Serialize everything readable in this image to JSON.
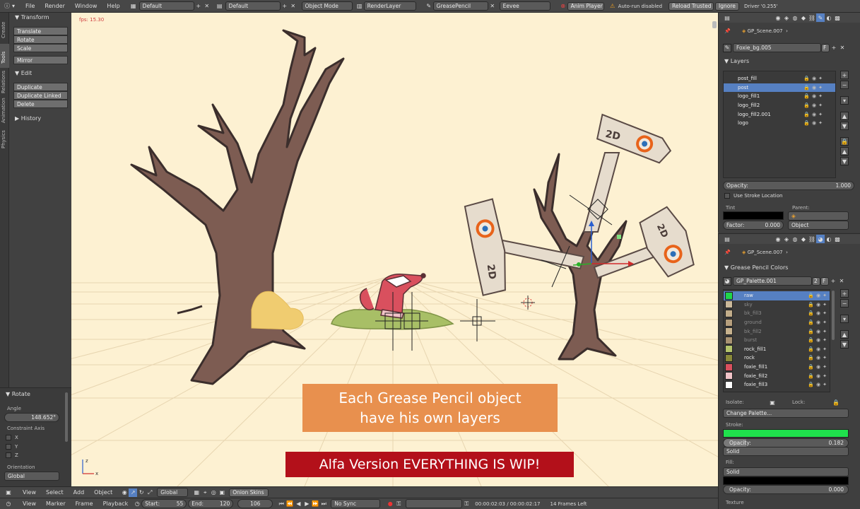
{
  "topbar": {
    "menus": [
      "File",
      "Render",
      "Window",
      "Help"
    ],
    "layout": "Default",
    "scene": "Default",
    "mode": "Object Mode",
    "render_layer": "RenderLayer",
    "object": "GreasePencil",
    "engine": "Eevee",
    "anim_player": "Anim Player",
    "autorun": "Auto-run disabled",
    "reload": "Reload Trusted",
    "ignore": "Ignore",
    "driver": "Driver '0.255'"
  },
  "vtabs": [
    "Create",
    "Tools",
    "Relations",
    "Animation",
    "Physics"
  ],
  "toolshelf": {
    "transform_header": "Transform",
    "transform_buttons": [
      "Translate",
      "Rotate",
      "Scale"
    ],
    "mirror": "Mirror",
    "edit_header": "Edit",
    "edit_buttons": [
      "Duplicate",
      "Duplicate Linked",
      "Delete"
    ],
    "history_header": "History"
  },
  "operator": {
    "header": "Rotate",
    "angle_label": "Angle",
    "angle_value": "148.652°",
    "constraint_label": "Constraint Axis",
    "axes": [
      "X",
      "Y",
      "Z"
    ],
    "orientation_label": "Orientation",
    "orientation_value": "Global"
  },
  "viewport": {
    "fps": "fps: 15.30",
    "caption_line1": "Each Grease Pencil object",
    "caption_line2": "have his own layers",
    "banner": "Alfa Version EVERYTHING IS WIP!",
    "sign_text": "2D",
    "axis_z": "z",
    "axis_x": "x"
  },
  "view3d_header": {
    "menus": [
      "View",
      "Select",
      "Add",
      "Object"
    ],
    "orientation": "Global",
    "onion": "Onion Skins"
  },
  "timeline": {
    "menus": [
      "View",
      "Marker",
      "Frame",
      "Playback"
    ],
    "start_label": "Start:",
    "start": "55",
    "end_label": "End:",
    "end": "120",
    "current": "106",
    "sync": "No Sync",
    "time": "00:00:02:03 / 00:00:02:17",
    "frames_left": "14 Frames Left"
  },
  "properties_top": {
    "breadcrumb": "GP_Scene.007",
    "datablock": "Foxie_bg.005",
    "datablock_flag": "F",
    "layers_header": "Layers",
    "layers": [
      {
        "name": "post_fill",
        "selected": false
      },
      {
        "name": "post",
        "selected": true
      },
      {
        "name": "logo_fill1",
        "selected": false
      },
      {
        "name": "logo_fill2",
        "selected": false
      },
      {
        "name": "logo_fill2.001",
        "selected": false
      },
      {
        "name": "logo",
        "selected": false
      }
    ],
    "opacity_label": "Opacity:",
    "opacity_value": "1.000",
    "stroke_location": "Use Stroke Location",
    "tint_label": "Tint",
    "parent_label": "Parent:",
    "factor_label": "Factor:",
    "factor_value": "0.000",
    "parent_type": "Object"
  },
  "properties_bottom": {
    "breadcrumb": "GP_Scene.007",
    "colors_header": "Grease Pencil Colors",
    "palette": "GP_Palette.001",
    "palette_users": "2",
    "palette_flag": "F",
    "colors": [
      {
        "name": "raw",
        "swatch": "#1fd64a",
        "selected": true,
        "dim": false
      },
      {
        "name": "sky",
        "swatch": "#cbb99a",
        "selected": false,
        "dim": true
      },
      {
        "name": "bk_fill3",
        "swatch": "#c2ad8a",
        "selected": false,
        "dim": true
      },
      {
        "name": "ground",
        "swatch": "#b69f7d",
        "selected": false,
        "dim": true
      },
      {
        "name": "bk_fill2",
        "swatch": "#c7b28e",
        "selected": false,
        "dim": true
      },
      {
        "name": "burst",
        "swatch": "#a89272",
        "selected": false,
        "dim": true
      },
      {
        "name": "rock_fill1",
        "swatch": "#b4c46b",
        "selected": false,
        "dim": false
      },
      {
        "name": "rock",
        "swatch": "#8a8a3a",
        "selected": false,
        "dim": false
      },
      {
        "name": "foxie_fill1",
        "swatch": "#d9505e",
        "selected": false,
        "dim": false
      },
      {
        "name": "foxie_fill2",
        "swatch": "#f1c4c8",
        "selected": false,
        "dim": false
      },
      {
        "name": "foxie_fill3",
        "swatch": "#ffffff",
        "selected": false,
        "dim": false
      }
    ],
    "isolate_label": "Isolate:",
    "lock_label": "Lock:",
    "change_palette": "Change Palette...",
    "stroke_label": "Stroke:",
    "stroke_color": "#1fe04c",
    "stroke_opacity_label": "Opacity:",
    "stroke_opacity": "0.182",
    "stroke_mode": "Solid",
    "fill_label": "Fill:",
    "fill_mode": "Solid",
    "fill_opacity_label": "Opacity:",
    "fill_opacity": "0.000",
    "texture_label": "Texture"
  },
  "colors": {
    "viewport_bg": "#fdf1d2",
    "selection": "#5680c2",
    "caption_bg": "#e8904e",
    "banner_bg": "#b3101a"
  }
}
